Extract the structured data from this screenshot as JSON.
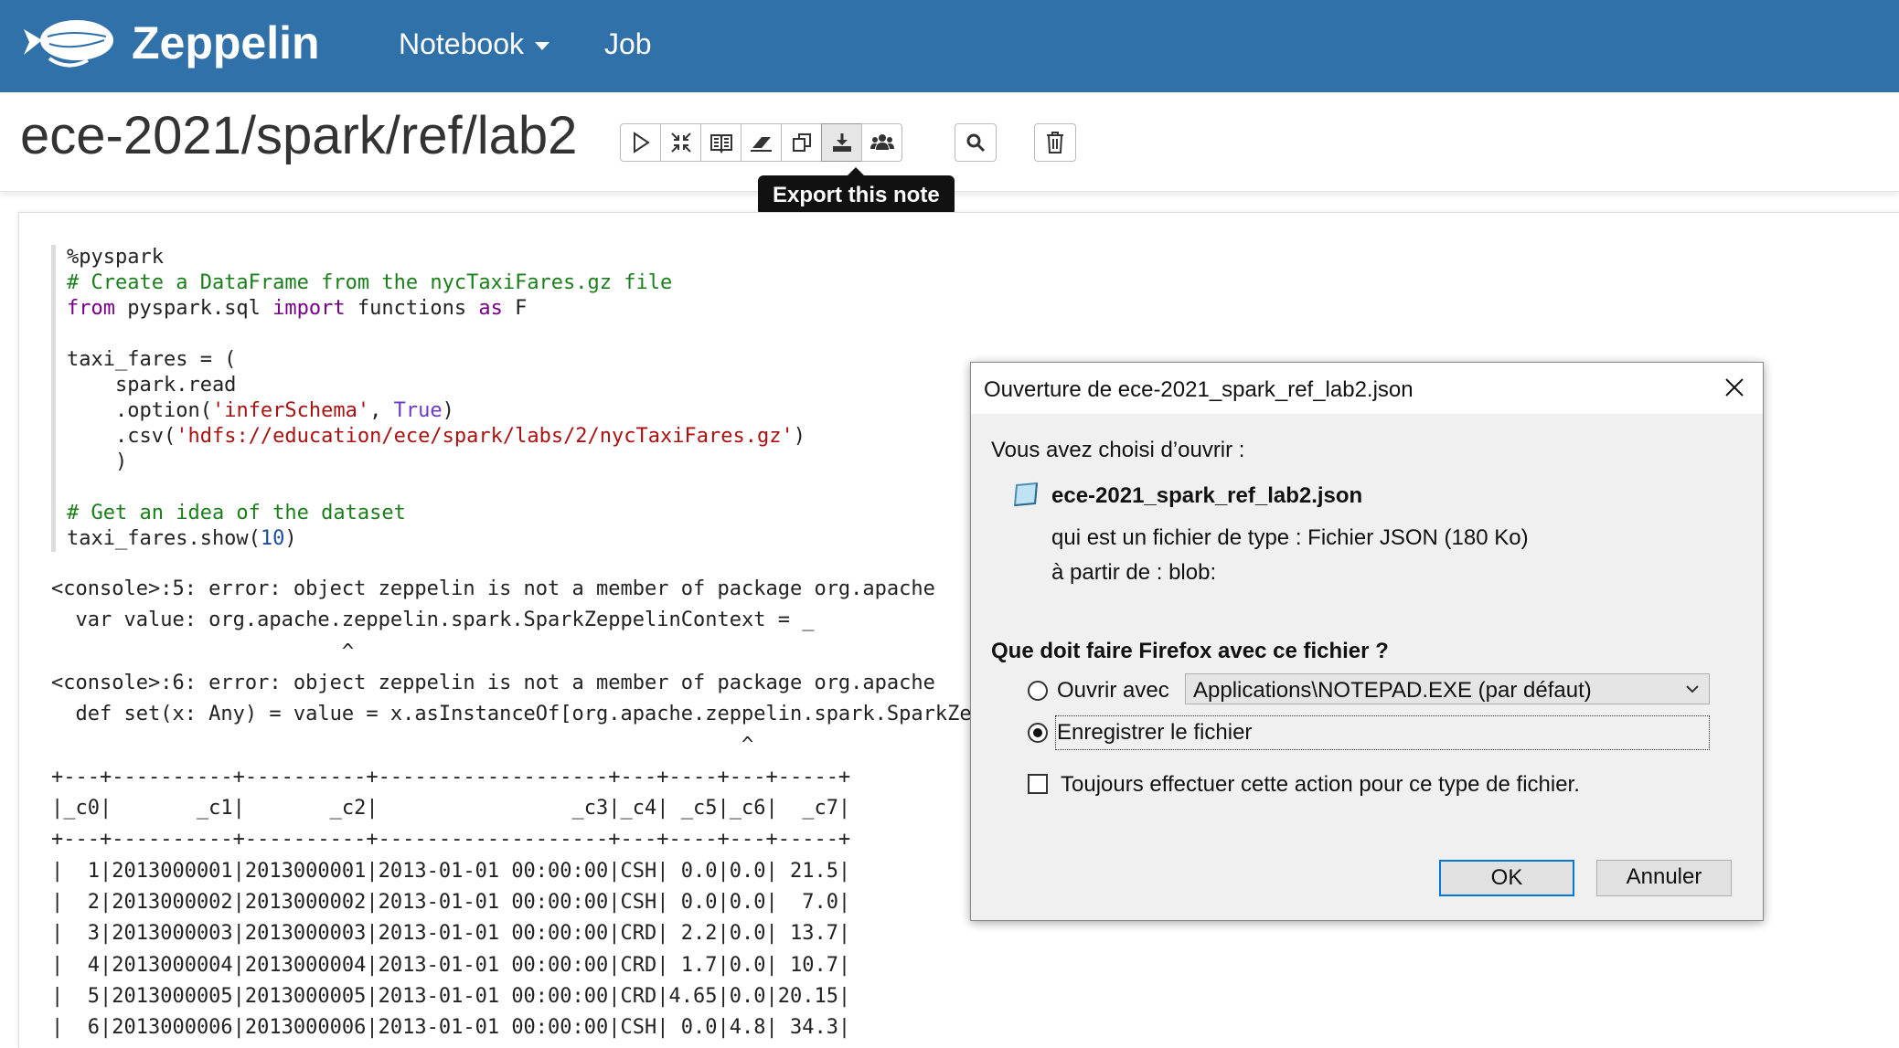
{
  "app": {
    "brand": "Zeppelin",
    "nav": {
      "notebook": "Notebook",
      "job": "Job"
    }
  },
  "note": {
    "title": "ece-2021/spark/ref/lab2",
    "tooltip": "Export this note",
    "toolbar_icons": [
      "run-all-icon",
      "collapse-icon",
      "book-icon",
      "eraser-icon",
      "clone-icon",
      "export-icon",
      "users-icon",
      "search-icon",
      "trash-icon"
    ]
  },
  "paragraph": {
    "code_lines": [
      {
        "t": "plain",
        "s": "%pyspark"
      },
      {
        "t": "comment",
        "s": "# Create a DataFrame from the nycTaxiFares.gz file"
      },
      {
        "t": "import",
        "parts": [
          "from",
          " pyspark.sql ",
          "import",
          " functions ",
          "as",
          " F"
        ]
      },
      {
        "t": "plain",
        "s": ""
      },
      {
        "t": "plain",
        "s": "taxi_fares = ("
      },
      {
        "t": "plain",
        "s": "    spark.read"
      },
      {
        "t": "option",
        "parts": [
          "    .option(",
          "'inferSchema'",
          ", ",
          "True",
          ")"
        ]
      },
      {
        "t": "csv",
        "parts": [
          "    .csv(",
          "'hdfs://education/ece/spark/labs/2/nycTaxiFares.gz'",
          ")"
        ]
      },
      {
        "t": "plain",
        "s": "    )"
      },
      {
        "t": "plain",
        "s": ""
      },
      {
        "t": "comment",
        "s": "# Get an idea of the dataset"
      },
      {
        "t": "show",
        "parts": [
          "taxi_fares.show(",
          "10",
          ")"
        ]
      }
    ],
    "output_lines": [
      "<console>:5: error: object zeppelin is not a member of package org.apache",
      "  var value: org.apache.zeppelin.spark.SparkZeppelinContext = _",
      "                        ^",
      "<console>:6: error: object zeppelin is not a member of package org.apache",
      "  def set(x: Any) = value = x.asInstanceOf[org.apache.zeppelin.spark.SparkZeppelinContext]",
      "                                                         ^",
      "+---+----------+----------+-------------------+---+----+---+-----+",
      "|_c0|       _c1|       _c2|                _c3|_c4| _c5|_c6|  _c7|",
      "+---+----------+----------+-------------------+---+----+---+-----+",
      "|  1|2013000001|2013000001|2013-01-01 00:00:00|CSH| 0.0|0.0| 21.5|",
      "|  2|2013000002|2013000002|2013-01-01 00:00:00|CSH| 0.0|0.0|  7.0|",
      "|  3|2013000003|2013000003|2013-01-01 00:00:00|CRD| 2.2|0.0| 13.7|",
      "|  4|2013000004|2013000004|2013-01-01 00:00:00|CRD| 1.7|0.0| 10.7|",
      "|  5|2013000005|2013000005|2013-01-01 00:00:00|CRD|4.65|0.0|20.15|",
      "|  6|2013000006|2013000006|2013-01-01 00:00:00|CSH| 0.0|4.8| 34.3|"
    ]
  },
  "dialog": {
    "title": "Ouverture de ece-2021_spark_ref_lab2.json",
    "intro": "Vous avez choisi d’ouvrir :",
    "filename": "ece-2021_spark_ref_lab2.json",
    "type_label": "qui est un fichier de type :",
    "type_value": "Fichier JSON (180 Ko)",
    "from_label": "à partir de :",
    "from_value": "blob:",
    "question": "Que doit faire Firefox avec ce fichier ?",
    "open_with_label": "Ouvrir avec",
    "open_with_app": "Applications\\NOTEPAD.EXE (par défaut)",
    "save_label": "Enregistrer le fichier",
    "always_label": "Toujours effectuer cette action pour ce type de fichier.",
    "ok": "OK",
    "cancel": "Annuler",
    "selected_option": "save"
  }
}
